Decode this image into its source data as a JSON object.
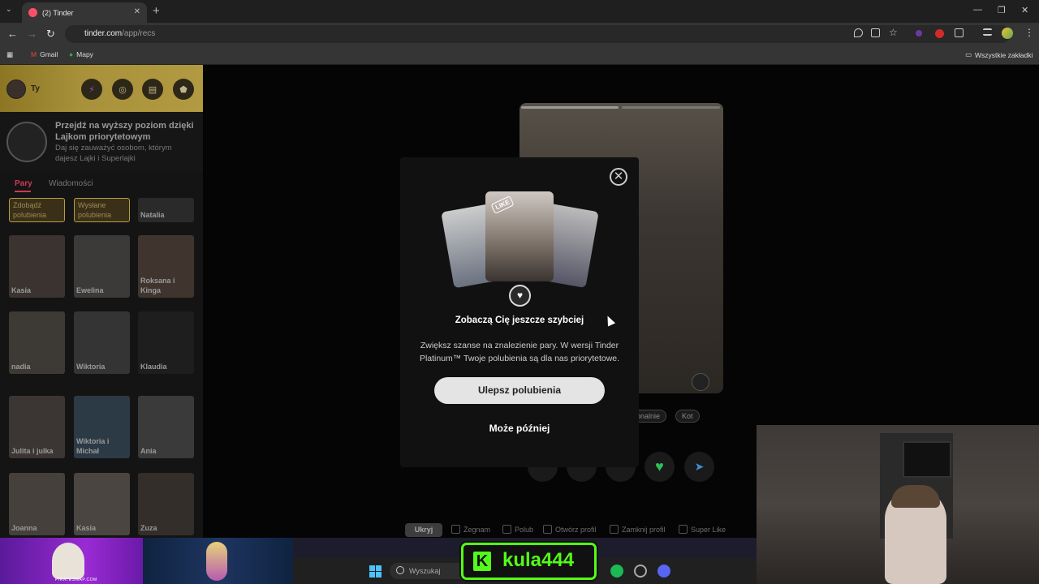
{
  "browser": {
    "tab_title": "(2) Tinder",
    "url_host": "tinder.com",
    "url_path": "/app/recs",
    "bookmarks": [
      "Gmail",
      "Mapy"
    ],
    "all_bookmarks": "Wszystkie zakładki"
  },
  "sidebar": {
    "user_label": "Ty",
    "promo_title": "Przejdź na wyższy poziom dzięki Lajkom priorytetowym",
    "promo_sub": "Daj się zauważyć osobom, którym dajesz Lajki i Superlajki",
    "tabs": [
      "Pary",
      "Wiadomości"
    ],
    "tiles": [
      {
        "name": "Zdobądź polubienia"
      },
      {
        "name": "Wysłane polubienia"
      },
      {
        "name": "Natalia"
      },
      {
        "name": "Kasia"
      },
      {
        "name": "Ewelina"
      },
      {
        "name": "Roksana i Kinga"
      },
      {
        "name": "nadia"
      },
      {
        "name": "Wiktoria"
      },
      {
        "name": "Klaudia"
      },
      {
        "name": "Julita i julka"
      },
      {
        "name": "Wiktoria i Michał"
      },
      {
        "name": "Ania"
      },
      {
        "name": "Joanna"
      },
      {
        "name": "Kasia"
      },
      {
        "name": "Zuza"
      }
    ]
  },
  "profile": {
    "chips": [
      "onalnie",
      "Kot"
    ]
  },
  "keyhints": {
    "hide": "Ukryj",
    "items": [
      "Żegnam",
      "Polub",
      "Otwórz profil",
      "Zamknij profil",
      "Super Like"
    ]
  },
  "modal": {
    "badge": "LIKE",
    "title": "Zobaczą Cię jeszcze szybciej",
    "body": "Zwiększ szanse na znalezienie pary. W wersji Tinder Platinum™ Twoje polubienia są dla nas priorytetowe.",
    "primary": "Ulepsz polubienia",
    "secondary": "Może później"
  },
  "overlay": {
    "pirate": "PIRATESWAP.COM",
    "search": "Wyszukaj",
    "kula": "kula444"
  },
  "colors": {
    "accent": "#cc3a55",
    "kick_green": "#53fc18",
    "gold": "#b29a42"
  }
}
